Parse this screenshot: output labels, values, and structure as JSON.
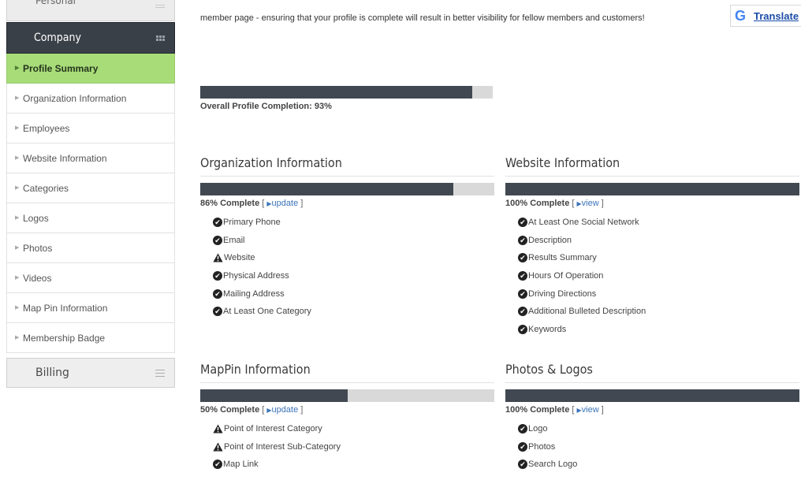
{
  "sidebar": {
    "cut_item": "Personal",
    "company": "Company",
    "items": [
      {
        "label": "Profile Summary",
        "active": true
      },
      {
        "label": "Organization Information"
      },
      {
        "label": "Employees"
      },
      {
        "label": "Website Information"
      },
      {
        "label": "Categories"
      },
      {
        "label": "Logos"
      },
      {
        "label": "Photos"
      },
      {
        "label": "Videos"
      },
      {
        "label": "Map Pin Information"
      },
      {
        "label": "Membership Badge"
      }
    ],
    "billing": "Billing"
  },
  "intro_text": "member page - ensuring that your profile is complete will result in better visibility for fellow members and customers!",
  "translate": {
    "g": "G",
    "label": "Translate"
  },
  "overall": {
    "label": "Overall Profile Completion: 93%",
    "percent": 93
  },
  "sections": [
    {
      "title": "Organization Information",
      "percent": 86,
      "pct_label": "86% Complete",
      "link": "update",
      "items": [
        {
          "label": "Primary Phone",
          "status": "ok"
        },
        {
          "label": "Email",
          "status": "ok"
        },
        {
          "label": "Website",
          "status": "warn"
        },
        {
          "label": "Physical Address",
          "status": "ok"
        },
        {
          "label": "Mailing Address",
          "status": "ok"
        },
        {
          "label": "At Least One Category",
          "status": "ok"
        }
      ]
    },
    {
      "title": "Website Information",
      "percent": 100,
      "pct_label": "100% Complete",
      "link": "view",
      "items": [
        {
          "label": "At Least One Social Network",
          "status": "ok"
        },
        {
          "label": "Description",
          "status": "ok"
        },
        {
          "label": "Results Summary",
          "status": "ok"
        },
        {
          "label": "Hours Of Operation",
          "status": "ok"
        },
        {
          "label": "Driving Directions",
          "status": "ok"
        },
        {
          "label": "Additional Bulleted Description",
          "status": "ok"
        },
        {
          "label": "Keywords",
          "status": "ok"
        }
      ]
    },
    {
      "title": "MapPin Information",
      "percent": 50,
      "pct_label": "50% Complete",
      "link": "update",
      "items": [
        {
          "label": "Point of Interest Category",
          "status": "warn"
        },
        {
          "label": "Point of Interest Sub-Category",
          "status": "warn"
        },
        {
          "label": "Map Link",
          "status": "ok"
        }
      ]
    },
    {
      "title": "Photos & Logos",
      "percent": 100,
      "pct_label": "100% Complete",
      "link": "view",
      "items": [
        {
          "label": "Logo",
          "status": "ok"
        },
        {
          "label": "Photos",
          "status": "ok"
        },
        {
          "label": "Search Logo",
          "status": "ok"
        }
      ]
    }
  ],
  "icons": {
    "ok": "check-circle-icon",
    "warn": "warning-triangle-icon"
  },
  "colors": {
    "active": "#a8dc79",
    "bar_fill": "#414851",
    "bar_bg": "#d9d9d9",
    "link": "#3b73b9"
  }
}
